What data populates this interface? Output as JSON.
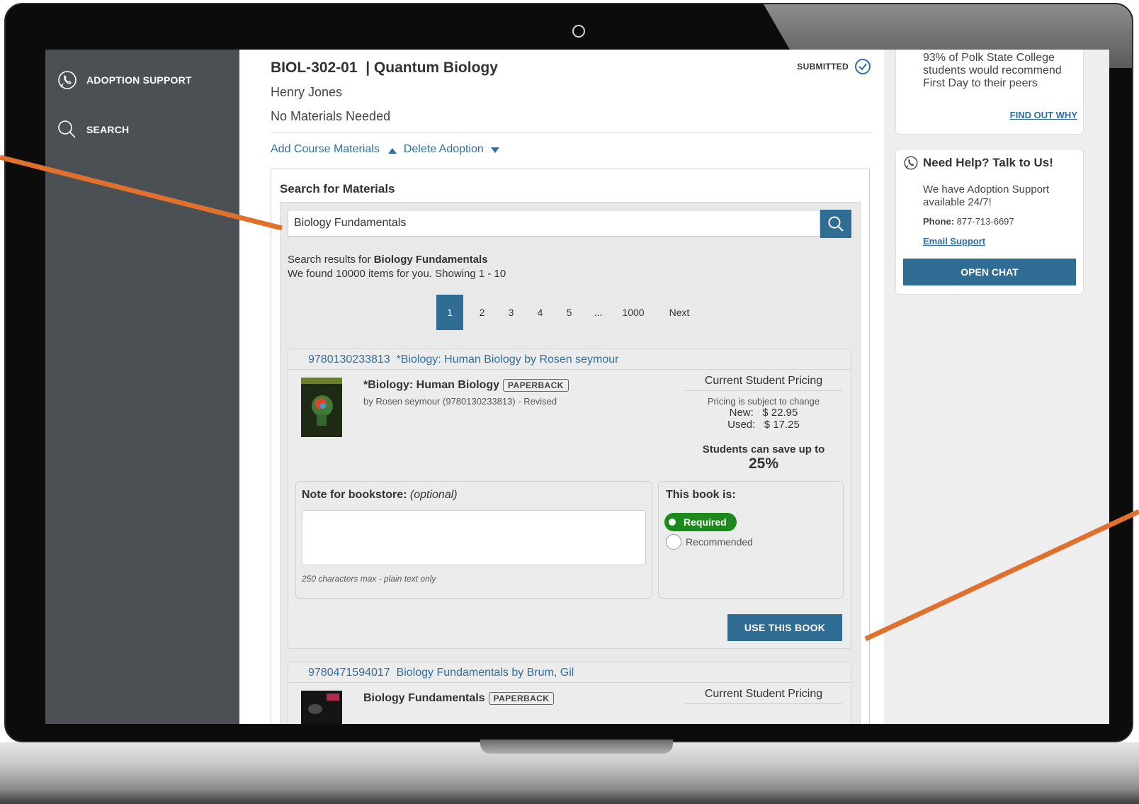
{
  "sidebar": {
    "items": [
      {
        "label": "ADOPTION SUPPORT",
        "icon": "phone-bubble-icon"
      },
      {
        "label": "SEARCH",
        "icon": "search-icon"
      }
    ]
  },
  "course": {
    "title": "BIOL-302-01  | Quantum Biology",
    "status": "SUBMITTED",
    "instructor": "Henry Jones",
    "materials_note": "No Materials Needed",
    "add_link": "Add Course Materials",
    "delete_link": "Delete Adoption"
  },
  "search": {
    "heading": "Search for Materials",
    "value": "Biology Fundamentals",
    "results_prefix": "Search results for ",
    "results_query": "Biology Fundamentals",
    "results_count": "We found 10000 items for you. Showing 1 - 10",
    "pages": [
      "1",
      "2",
      "3",
      "4",
      "5",
      "...",
      "1000",
      "Next"
    ],
    "current_page": "1"
  },
  "results": [
    {
      "header": "9780130233813  *Biology: Human Biology by Rosen seymour",
      "title": "*Biology: Human Biology",
      "format": "PAPERBACK",
      "byline": "by Rosen seymour (9780130233813) - Revised",
      "pricing_heading": "Current Student Pricing",
      "pricing_note": "Pricing is subject to change",
      "new_price": "New:   $ 22.95",
      "used_price": "Used:   $ 17.25",
      "save_text": "Students can save up to",
      "save_pct": "25%",
      "note_label": "Note for bookstore:",
      "note_optional": "(optional)",
      "note_hint": "250 characters max - plain text only",
      "req_label": "This book is:",
      "required": "Required",
      "recommended": "Recommended",
      "use_button": "USE THIS BOOK"
    },
    {
      "header": "9780471594017  Biology Fundamentals by Brum, Gil",
      "title": "Biology Fundamentals",
      "format": "PAPERBACK",
      "pricing_heading": "Current Student Pricing"
    }
  ],
  "promo": {
    "text": "93% of Polk State College students would recommend First Day to their peers",
    "link": "FIND OUT WHY"
  },
  "help": {
    "title": "Need Help? Talk to Us!",
    "text": "We have Adoption Support available 24/7!",
    "phone_label": "Phone:",
    "phone": "877-713-6697",
    "email": "Email Support",
    "chat": "OPEN CHAT"
  },
  "colors": {
    "accent": "#2f6d94",
    "link": "#2f6f9e",
    "sidebar": "#4b5054",
    "required": "#1b8a1b",
    "callout": "#e0702e"
  }
}
